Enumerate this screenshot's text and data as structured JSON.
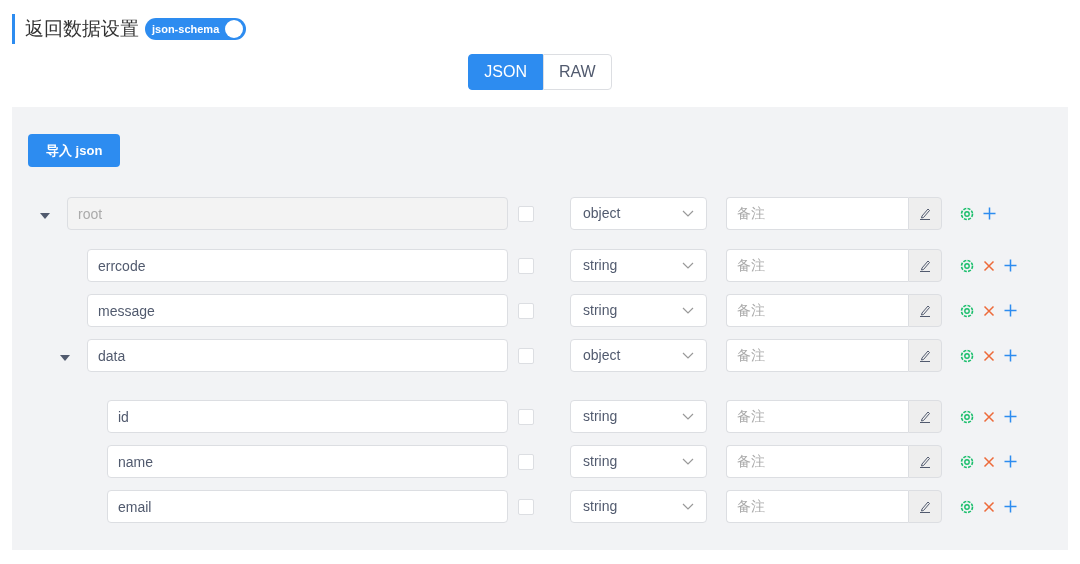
{
  "header": {
    "title": "返回数据设置",
    "toggle": {
      "label": "json-schema",
      "on": true
    }
  },
  "tabs": [
    {
      "label": "JSON",
      "selected": true
    },
    {
      "label": "RAW",
      "selected": false
    }
  ],
  "import_button": "导入 json",
  "tree": [
    {
      "name": "root",
      "disabled": true,
      "required": false,
      "type": "object",
      "note_placeholder": "备注",
      "removable": false,
      "expanded": true,
      "children": [
        {
          "name": "errcode",
          "disabled": false,
          "required": false,
          "type": "string",
          "note_placeholder": "备注",
          "removable": true
        },
        {
          "name": "message",
          "disabled": false,
          "required": false,
          "type": "string",
          "note_placeholder": "备注",
          "removable": true
        },
        {
          "name": "data",
          "disabled": false,
          "required": false,
          "type": "object",
          "note_placeholder": "备注",
          "removable": true,
          "expanded": true,
          "children": [
            {
              "name": "id",
              "disabled": false,
              "required": false,
              "type": "string",
              "note_placeholder": "备注",
              "removable": true
            },
            {
              "name": "name",
              "disabled": false,
              "required": false,
              "type": "string",
              "note_placeholder": "备注",
              "removable": true
            },
            {
              "name": "email",
              "disabled": false,
              "required": false,
              "type": "string",
              "note_placeholder": "备注",
              "removable": true
            }
          ]
        }
      ]
    }
  ]
}
